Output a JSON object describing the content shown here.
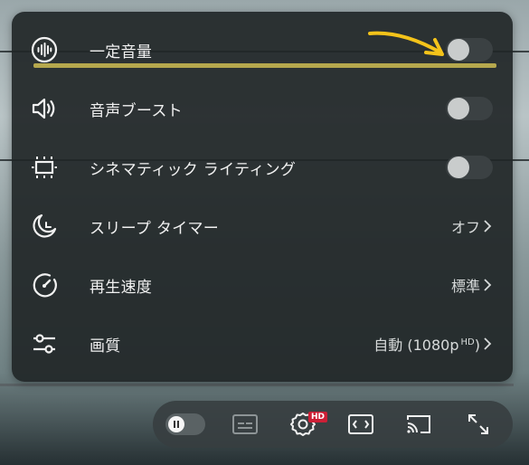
{
  "menu": {
    "items": [
      {
        "icon": "stable-volume-icon",
        "label": "一定音量",
        "type": "toggle",
        "on": false
      },
      {
        "icon": "speaker-icon",
        "label": "音声ブースト",
        "type": "toggle",
        "on": false
      },
      {
        "icon": "ambient-mode-icon",
        "label": "シネマティック ライティング",
        "type": "toggle",
        "on": false
      },
      {
        "icon": "sleep-timer-icon",
        "label": "スリープ タイマー",
        "type": "link",
        "value": "オフ"
      },
      {
        "icon": "playback-speed-icon",
        "label": "再生速度",
        "type": "link",
        "value": "標準"
      },
      {
        "icon": "quality-sliders-icon",
        "label": "画質",
        "type": "link",
        "value": "自動 (1080p",
        "value_sup": "HD",
        "value_suffix": ")"
      }
    ]
  },
  "controls": {
    "hd_badge": "HD",
    "buttons": [
      "autoplay-toggle",
      "subtitles-icon",
      "settings-gear-icon",
      "theater-mode-icon",
      "cast-icon",
      "fullscreen-icon"
    ]
  },
  "colors": {
    "menu_bg": "#212627",
    "highlight": "#b6a84d",
    "arrow": "#f4c31a",
    "hd_badge": "#cc1f36"
  }
}
